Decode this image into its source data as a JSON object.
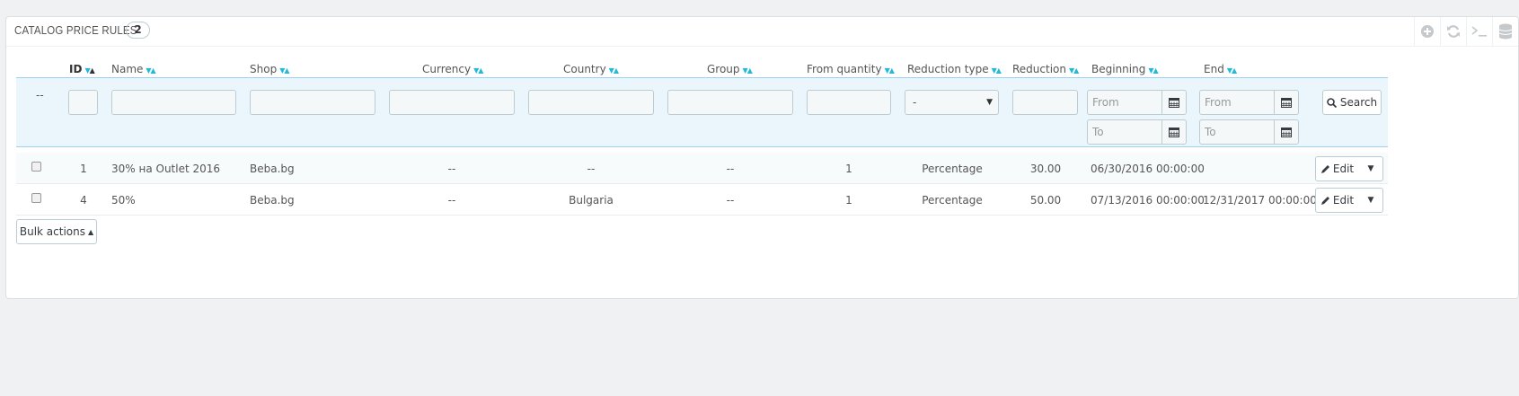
{
  "panel": {
    "title": "CATALOG PRICE RULES",
    "count": "2"
  },
  "toolbar": {
    "icons": [
      "add-icon",
      "refresh-icon",
      "sql-query-icon",
      "export-icon"
    ]
  },
  "columns": [
    {
      "label": "ID",
      "active": true
    },
    {
      "label": "Name"
    },
    {
      "label": "Shop"
    },
    {
      "label": "Currency"
    },
    {
      "label": "Country"
    },
    {
      "label": "Group"
    },
    {
      "label": "From quantity"
    },
    {
      "label": "Reduction type"
    },
    {
      "label": "Reduction"
    },
    {
      "label": "Beginning"
    },
    {
      "label": "End"
    }
  ],
  "filters": {
    "checkbox_placeholder": "--",
    "reduction_type_selected": "-",
    "beginning_from": "From",
    "beginning_to": "To",
    "end_from": "From",
    "end_to": "To",
    "search_label": "Search"
  },
  "rows": [
    {
      "id": "1",
      "name": "30% на Outlet 2016",
      "shop": "Beba.bg",
      "currency": "--",
      "country": "--",
      "group": "--",
      "from_quantity": "1",
      "reduction_type": "Percentage",
      "reduction": "30.00",
      "beginning": "06/30/2016 00:00:00",
      "end": "",
      "action": "Edit"
    },
    {
      "id": "4",
      "name": "50%",
      "shop": "Beba.bg",
      "currency": "--",
      "country": "Bulgaria",
      "group": "--",
      "from_quantity": "1",
      "reduction_type": "Percentage",
      "reduction": "50.00",
      "beginning": "07/13/2016 00:00:00",
      "end": "12/31/2017 00:00:00",
      "action": "Edit"
    }
  ],
  "bulk_actions": {
    "label": "Bulk actions"
  }
}
